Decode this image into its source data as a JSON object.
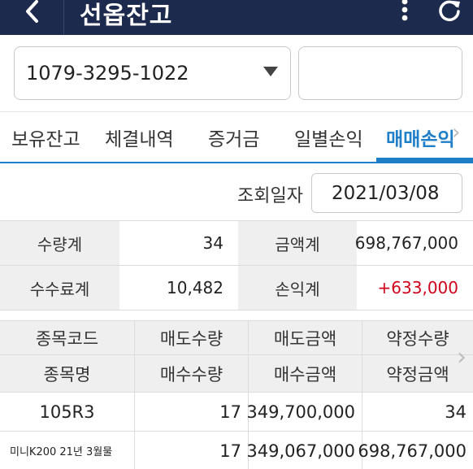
{
  "header": {
    "title": "선옵잔고",
    "back_icon": "chevron-left-icon",
    "more_icon": "vertical-dots-icon",
    "refresh_icon": "refresh-icon",
    "bg_color": "#1c2a4d"
  },
  "account": {
    "number": "1079-3295-1022",
    "password_placeholder": ""
  },
  "tabs": [
    {
      "label": "보유잔고"
    },
    {
      "label": "체결내역"
    },
    {
      "label": "증거금"
    },
    {
      "label": "일별손익"
    },
    {
      "label": "매매손익",
      "active": true
    }
  ],
  "query": {
    "label": "조회일자",
    "date": "2021/03/08"
  },
  "summary": {
    "qty_label": "수량계",
    "qty_value": "34",
    "amount_label": "금액계",
    "amount_value": "698,767,000",
    "fee_label": "수수료계",
    "fee_value": "10,482",
    "pnl_label": "손익계",
    "pnl_value": "+633,000",
    "pnl_color": "#d0021b"
  },
  "detail": {
    "headers_row1": [
      "종목코드",
      "매도수량",
      "매도금액",
      "약정수량"
    ],
    "headers_row2": [
      "종목명",
      "매수수량",
      "매수금액",
      "약정금액"
    ],
    "rows": [
      [
        "105R3",
        "17",
        "349,700,000",
        "34"
      ],
      [
        "미니K200 21년 3월물",
        "17",
        "349,067,000",
        "698,767,000"
      ]
    ]
  },
  "accent_color": "#1e7ec8"
}
